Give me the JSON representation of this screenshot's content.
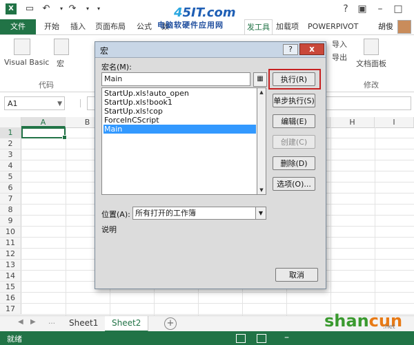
{
  "window": {
    "app_icon": "excel-icon",
    "watermark_logo_num": "4",
    "watermark_logo_text": "5IT.com",
    "watermark_sub": "电脑软硬件应用网"
  },
  "ribbon_tabs": {
    "file": "文件",
    "items": [
      "开始",
      "插入",
      "页面布局",
      "公式",
      "数",
      "发工具",
      "加载项",
      "POWERPIVOT"
    ],
    "active": "发工具",
    "user": "胡俊"
  },
  "ribbon": {
    "visual_basic": "Visual Basic",
    "macros": "宏",
    "code_group": "代码",
    "import": "导入",
    "export": "导出",
    "doc_panel": "文档面板",
    "modify_group": "修改"
  },
  "formula_bar": {
    "name_box": "A1",
    "formula": ""
  },
  "grid": {
    "columns": [
      "A",
      "B",
      "",
      "",
      "",
      "",
      "",
      "H",
      "I"
    ],
    "rows": [
      "1",
      "2",
      "3",
      "4",
      "5",
      "6",
      "7",
      "8",
      "9",
      "10",
      "11",
      "12",
      "13",
      "14",
      "15",
      "16",
      "17"
    ],
    "selected_cell": "A1"
  },
  "sheets": {
    "tabs": [
      "Sheet1",
      "Sheet2"
    ],
    "active": "Sheet2",
    "add_icon": "plus-circle-icon"
  },
  "status": {
    "text": "就绪"
  },
  "site_watermark": {
    "part_a": "shan",
    "part_b": "cun",
    "sub": ".net"
  },
  "dialog": {
    "title": "宏",
    "help": "?",
    "close": "x",
    "macro_name_label": "宏名(M):",
    "macro_name_value": "Main",
    "macros": [
      "StartUp.xls!auto_open",
      "StartUp.xls!book1",
      "StartUp.xls!cop",
      "ForceInCScript",
      "Main"
    ],
    "selected_macro": "Main",
    "location_label": "位置(A):",
    "location_value": "所有打开的工作簿",
    "description_label": "说明",
    "buttons": {
      "run": "执行(R)",
      "step_into": "单步执行(S)",
      "edit": "编辑(E)",
      "create": "创建(C)",
      "delete": "删除(D)",
      "options": "选项(O)...",
      "cancel": "取消"
    }
  }
}
